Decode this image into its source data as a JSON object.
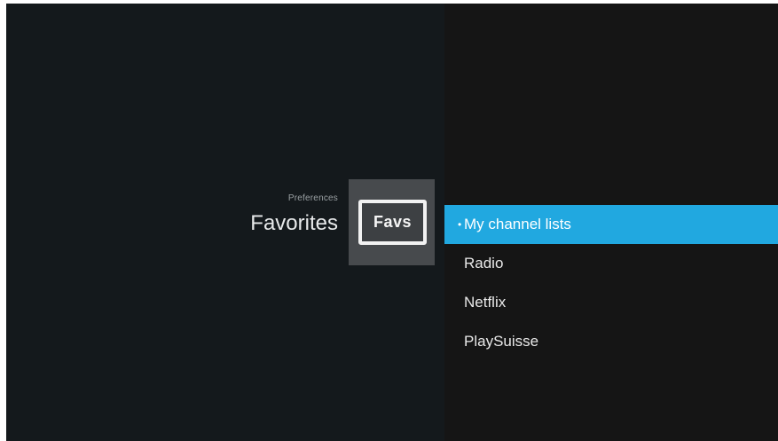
{
  "header": {
    "breadcrumb": "Preferences",
    "title": "Favorites"
  },
  "icon": {
    "name": "favs-icon",
    "label": "Favs"
  },
  "menu": {
    "items": [
      {
        "label": "My channel lists",
        "selected": true
      },
      {
        "label": "Radio",
        "selected": false
      },
      {
        "label": "Netflix",
        "selected": false
      },
      {
        "label": "PlaySuisse",
        "selected": false
      }
    ]
  },
  "colors": {
    "accent": "#21a8e0",
    "background_left": "#14191c",
    "background_right": "#151515",
    "icon_tile": "#474a4d"
  }
}
